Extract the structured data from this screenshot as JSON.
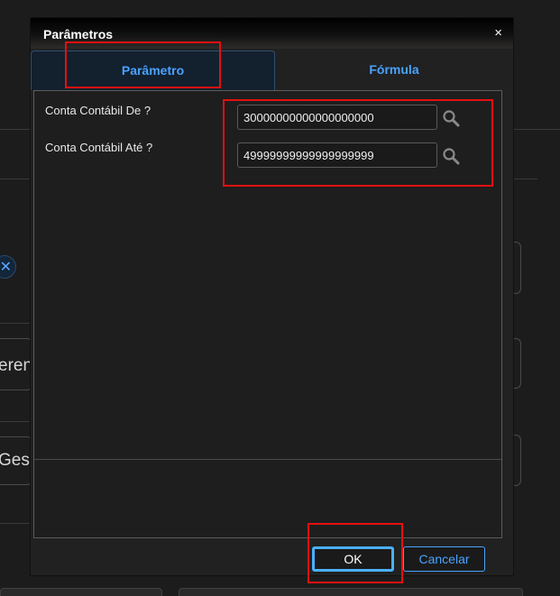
{
  "background": {
    "chip_close_glyph": "✕",
    "text_row_1": "eren",
    "text_row_2": "Gesp"
  },
  "dialog": {
    "title": "Parâmetros",
    "close_glyph": "×",
    "tabs": [
      {
        "label": "Parâmetro",
        "active": true
      },
      {
        "label": "Fórmula",
        "active": false
      }
    ],
    "params": [
      {
        "label": "Conta Contábil De ?",
        "value": "30000000000000000000",
        "lookup_icon": "search-icon"
      },
      {
        "label": "Conta Contábil Até ?",
        "value": "49999999999999999999",
        "lookup_icon": "search-icon"
      }
    ],
    "buttons": {
      "ok_label": "OK",
      "cancel_label": "Cancelar"
    }
  },
  "colors": {
    "accent": "#4aa3ff",
    "annotation": "#e41010",
    "dialog_bg": "#212121"
  }
}
